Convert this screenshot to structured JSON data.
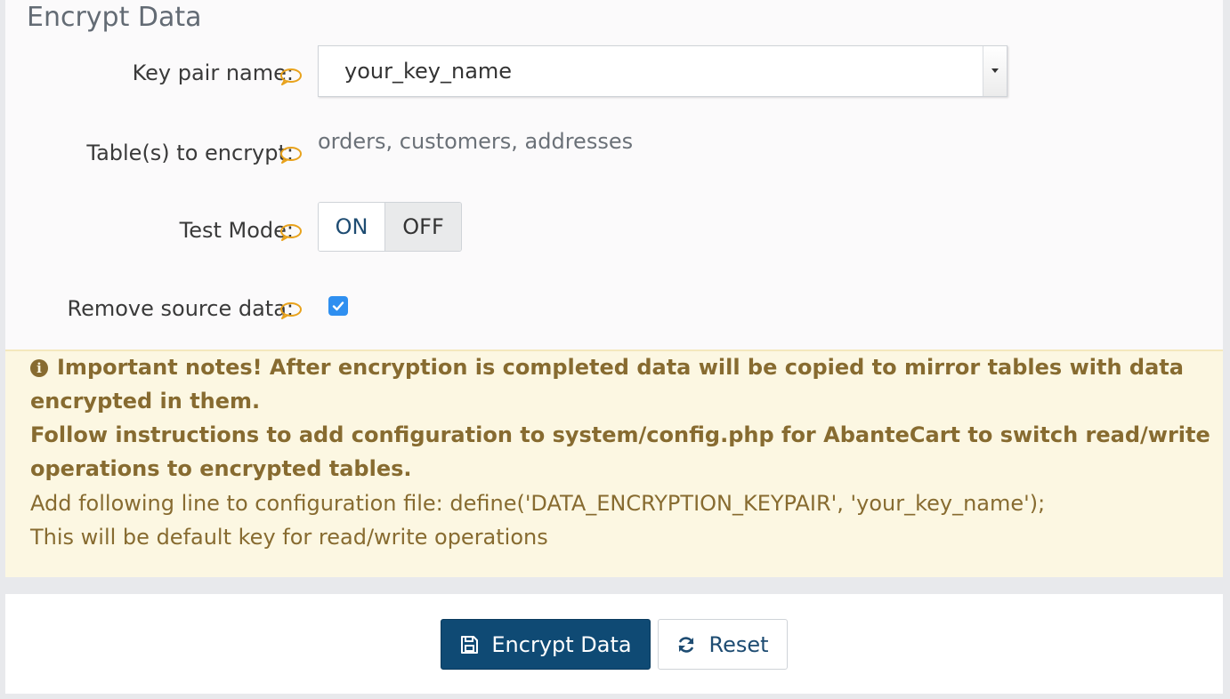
{
  "section": {
    "title": "Encrypt Data"
  },
  "form": {
    "key_pair": {
      "label": "Key pair name:",
      "value": "your_key_name"
    },
    "tables": {
      "label": "Table(s) to encrypt:",
      "value": "orders, customers, addresses"
    },
    "test_mode": {
      "label": "Test Mode:",
      "on_label": "ON",
      "off_label": "OFF",
      "selected": "OFF"
    },
    "remove_source": {
      "label": "Remove source data:",
      "checked": true
    }
  },
  "notes": {
    "line1": "Important notes! After encryption is completed data will be copied to mirror tables with data",
    "line2": "encrypted in them.",
    "line3": "Follow instructions to add configuration to system/config.php for AbanteCart to switch read/write",
    "line4": "operations to encrypted tables.",
    "line5": "Add following line to configuration file: define('DATA_ENCRYPTION_KEYPAIR', 'your_key_name');",
    "line6": "This will be default key for read/write operations"
  },
  "actions": {
    "encrypt_label": "Encrypt Data",
    "reset_label": "Reset"
  },
  "colors": {
    "primary": "#0f4a74",
    "hint": "#e8a21c",
    "notes_bg": "#fcf7e2",
    "notes_text": "#876b30",
    "checkbox": "#2f8ff0"
  },
  "icons": {
    "hint": "comment-icon",
    "info": "info-circle-icon",
    "save": "save-icon",
    "reset": "refresh-icon"
  }
}
